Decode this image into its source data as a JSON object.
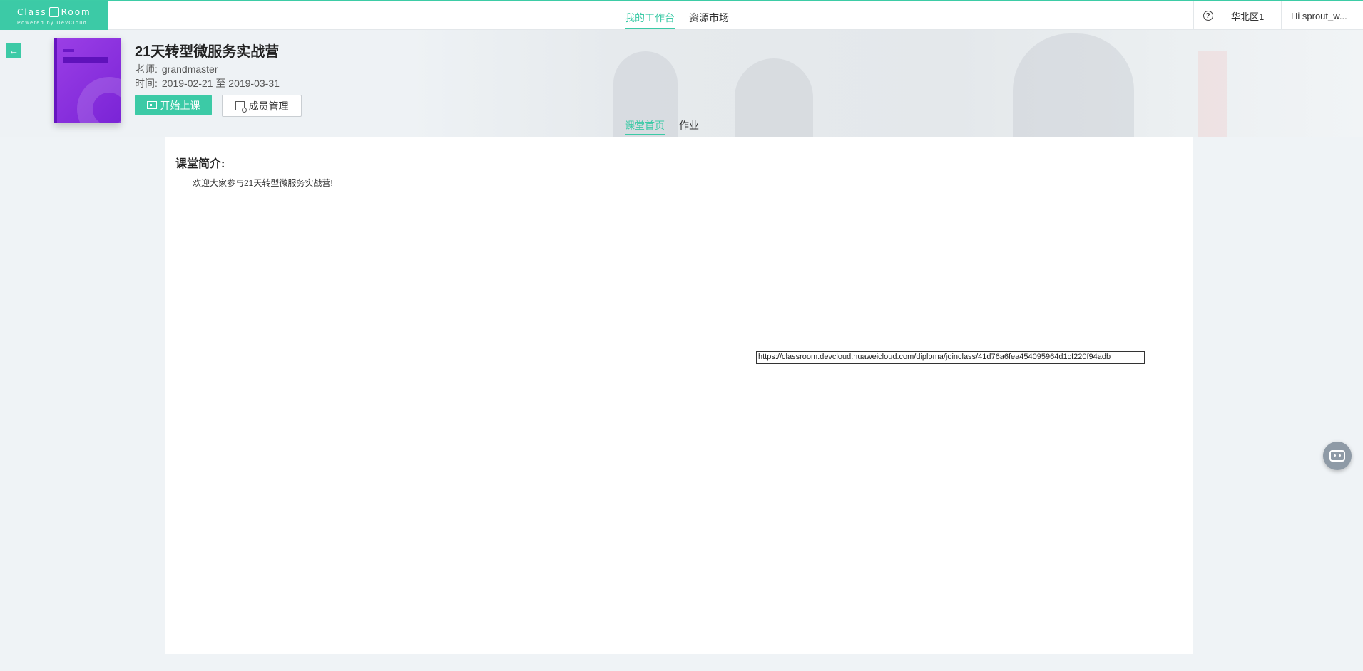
{
  "app": {
    "logo_text": "Class",
    "logo_text2": "Room",
    "logo_sub": "Powered by DevCloud"
  },
  "topnav": {
    "items": [
      {
        "label": "我的工作台",
        "active": true
      },
      {
        "label": "资源市场",
        "active": false
      }
    ]
  },
  "topright": {
    "help_icon": "?",
    "region": "华北区1",
    "user": "Hi sprout_w..."
  },
  "course": {
    "title": "21天转型微服务实战营",
    "teacher_label": "老师:",
    "teacher": "grandmaster",
    "time_label": "时间:",
    "time": "2019-02-21 至 2019-03-31",
    "start_button": "开始上课",
    "members_button": "成员管理"
  },
  "subtabs": [
    {
      "label": "课堂首页",
      "active": true
    },
    {
      "label": "作业",
      "active": false
    }
  ],
  "intro": {
    "title": "课堂简介:",
    "text": "欢迎大家参与21天转型微服务实战营!"
  },
  "url_field": {
    "value": "https://classroom.devcloud.huaweicloud.com/diploma/joinclass/41d76a6fea454095964d1cf220f94adb"
  },
  "colors": {
    "accent": "#3ccaa6",
    "cover": "#8a2fe0"
  }
}
